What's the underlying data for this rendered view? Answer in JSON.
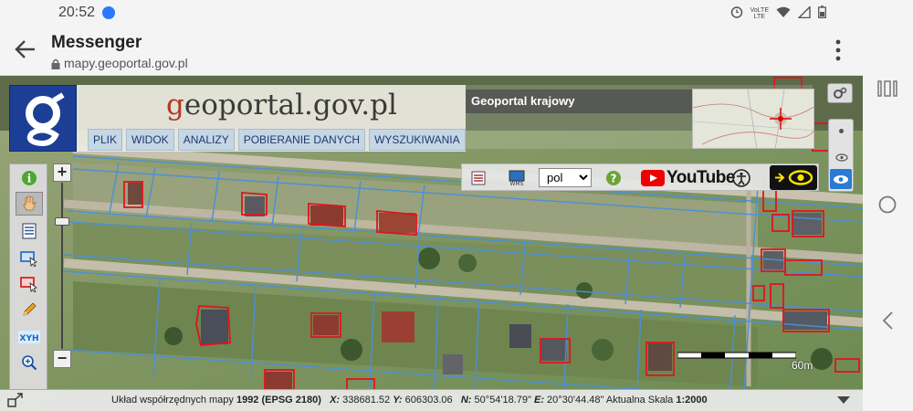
{
  "status_bar": {
    "time": "20:52",
    "network": "LTE",
    "network_top": "VoLTE"
  },
  "toolbar": {
    "title": "Messenger",
    "url": "mapy.geoportal.gov.pl"
  },
  "geoportal": {
    "brand_g": "g",
    "brand_rest": "eoportal.gov.pl",
    "menu": [
      "PLIK",
      "WIDOK",
      "ANALIZY",
      "POBIERANIE DANYCH",
      "WYSZUKIWANIA"
    ],
    "krajowy_label": "Geoportal krajowy",
    "language": "pol",
    "youtube_text": "YouTube"
  },
  "left_tools": [
    {
      "name": "info-icon"
    },
    {
      "name": "pan-hand-icon"
    },
    {
      "name": "legend-icon"
    },
    {
      "name": "select-blue-icon"
    },
    {
      "name": "select-red-icon"
    },
    {
      "name": "pencil-icon"
    },
    {
      "name": "xyh-icon",
      "label": "XYH"
    },
    {
      "name": "zoom-search-icon"
    }
  ],
  "zoom": {
    "plus": "+",
    "minus": "−"
  },
  "scale": {
    "label": "60m"
  },
  "info_bar": {
    "crs_prefix": "Układ współrzędnych mapy ",
    "crs_value": "1992 (EPSG 2180)",
    "x_label": "X:",
    "x_value": " 338681.52 ",
    "y_label": "Y:",
    "y_value": " 606303.06 ",
    "n_label": "N:",
    "n_value": " 50°54'18.79\" ",
    "e_label": "E:",
    "e_value": " 20°30'44.48\" ",
    "scale_prefix": " Aktualna Skala ",
    "scale_value": "1:2000"
  },
  "colors": {
    "parcel_line": "#4d8fd6",
    "building_outline": "#e0141e",
    "logo_blue": "#1c3f95",
    "menu_bg": "#c5d6e5"
  }
}
